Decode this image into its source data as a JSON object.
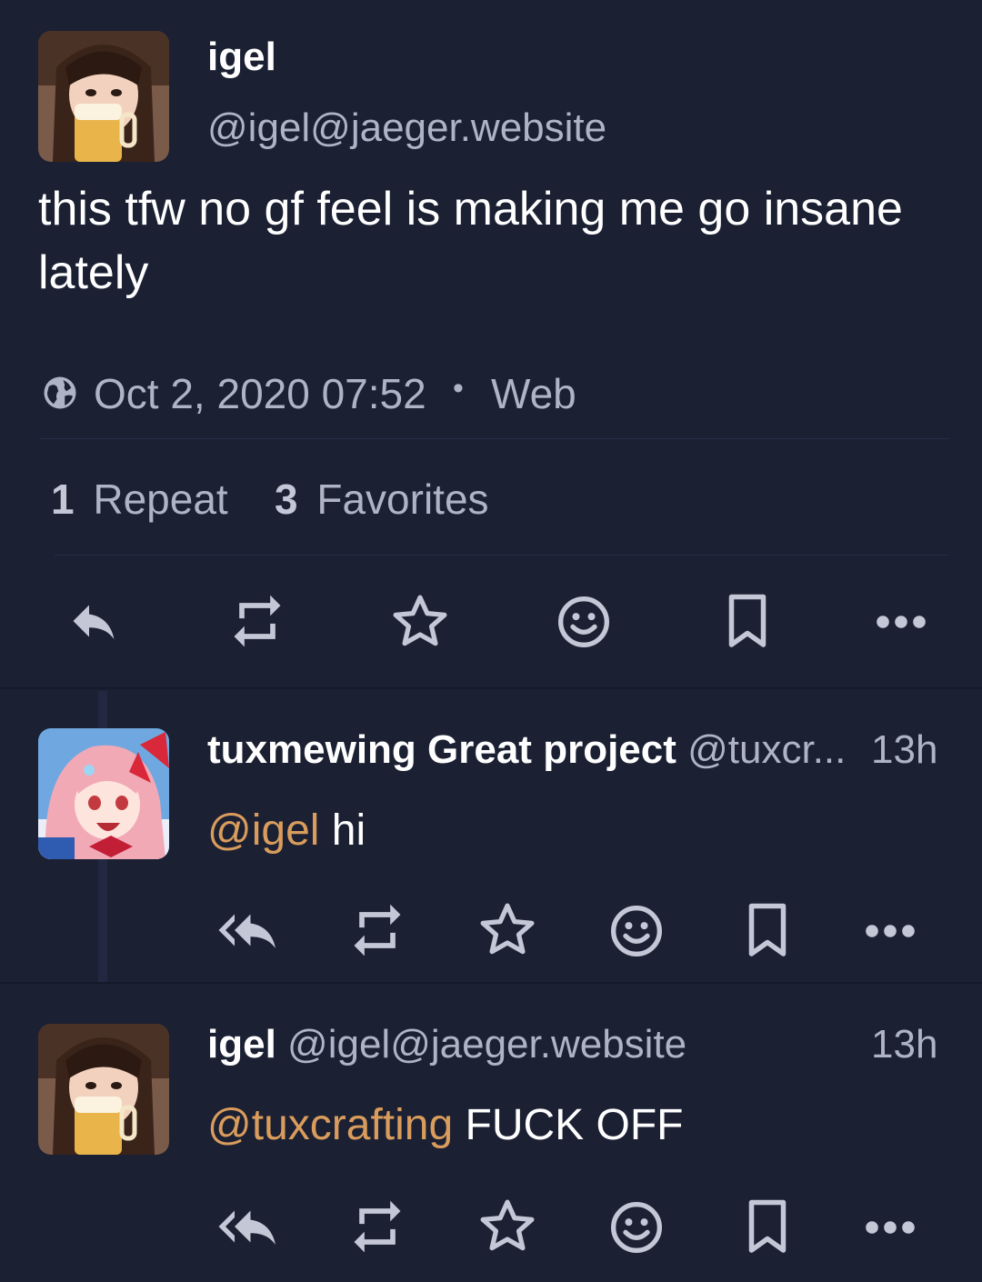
{
  "main_post": {
    "display_name": "igel",
    "handle": "@igel@jaeger.website",
    "content_line1": "this tfw no gf feel is making me go insane",
    "content_line2": "lately",
    "timestamp": "Oct 2, 2020 07:52",
    "separator": "•",
    "client": "Web",
    "repeat_count": "1",
    "repeat_label": "Repeat",
    "favorite_count": "3",
    "favorite_label": "Favorites",
    "actions": [
      "reply-icon",
      "repeat-icon",
      "star-icon",
      "emoji-icon",
      "bookmark-icon",
      "more-icon"
    ]
  },
  "replies": [
    {
      "display_name": "tuxmewing Great project",
      "handle": "@tuxcr...",
      "time": "13h",
      "mention": "@igel",
      "text": " hi",
      "actions": [
        "reply-all-icon",
        "repeat-icon",
        "star-icon",
        "emoji-icon",
        "bookmark-icon",
        "more-icon"
      ]
    },
    {
      "display_name": "igel",
      "handle": "@igel@jaeger.website",
      "time": "13h",
      "mention": "@tuxcrafting",
      "text": " FUCK OFF",
      "actions": [
        "reply-all-icon",
        "repeat-icon",
        "star-icon",
        "emoji-icon",
        "bookmark-icon",
        "more-icon"
      ]
    }
  ],
  "colors": {
    "background": "#1b2033",
    "text": "#ffffff",
    "muted": "#aeb3c5",
    "mention": "#d99c5c",
    "icon": "#c3c7d6"
  }
}
